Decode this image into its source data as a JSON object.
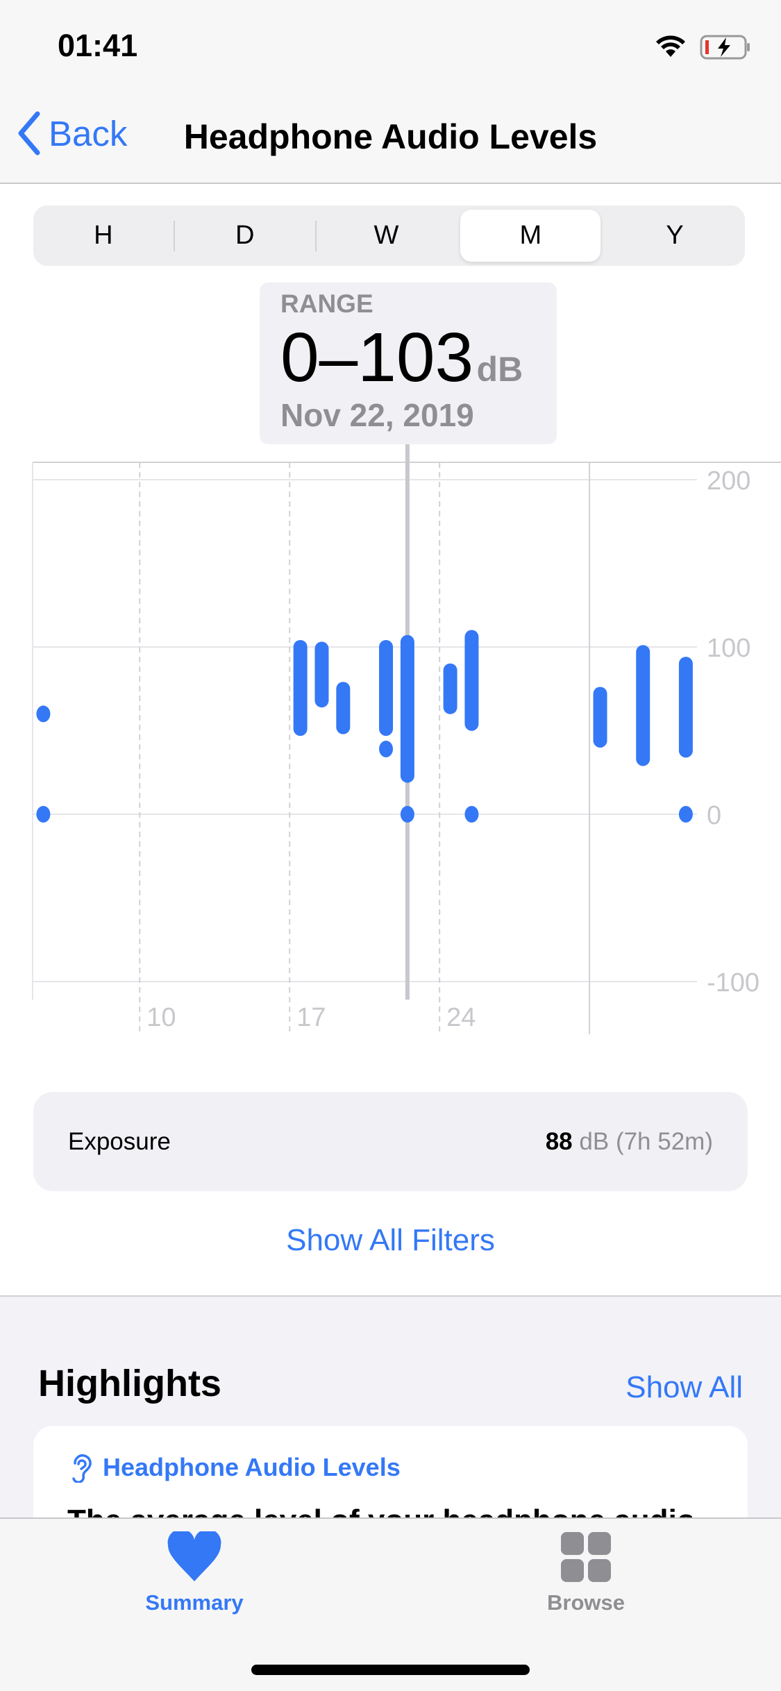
{
  "status_bar": {
    "time": "01:41",
    "wifi_icon": "wifi-icon",
    "battery_icon": "battery-charging-low-icon"
  },
  "nav": {
    "back_label": "Back",
    "title": "Headphone Audio Levels"
  },
  "segments": {
    "items": [
      "H",
      "D",
      "W",
      "M",
      "Y"
    ],
    "selected": "M"
  },
  "tooltip": {
    "label": "RANGE",
    "value": "0–103",
    "unit": "dB",
    "date": "Nov 22, 2019"
  },
  "chart_data": {
    "type": "range",
    "ylim": [
      -100,
      200
    ],
    "y_ticks": [
      "200",
      "100",
      "0",
      "-100"
    ],
    "x_range": [
      "Nov 5",
      "Dec 5"
    ],
    "x_tick_labels": [
      "10",
      "17",
      "24"
    ],
    "month_boundary": "Dec 1",
    "selected": "Nov 22",
    "grid": true,
    "color": "#3478F6",
    "points": [
      {
        "date": "Nov 5",
        "ranges": [],
        "dots": [
          60,
          0
        ]
      },
      {
        "date": "Nov 17",
        "ranges": [
          [
            51,
            100
          ]
        ],
        "dots": []
      },
      {
        "date": "Nov 18",
        "ranges": [
          [
            68,
            99
          ]
        ],
        "dots": []
      },
      {
        "date": "Nov 19",
        "ranges": [
          [
            52,
            75
          ]
        ],
        "dots": []
      },
      {
        "date": "Nov 21",
        "ranges": [
          [
            51,
            100
          ]
        ],
        "dots": [
          39
        ]
      },
      {
        "date": "Nov 22",
        "ranges": [
          [
            23,
            103
          ]
        ],
        "dots": [
          0
        ]
      },
      {
        "date": "Nov 24",
        "ranges": [
          [
            64,
            86
          ]
        ],
        "dots": []
      },
      {
        "date": "Nov 25",
        "ranges": [
          [
            54,
            106
          ]
        ],
        "dots": [
          0
        ]
      },
      {
        "date": "Dec 1",
        "ranges": [
          [
            44,
            72
          ]
        ],
        "dots": []
      },
      {
        "date": "Dec 3",
        "ranges": [
          [
            33,
            97
          ]
        ],
        "dots": []
      },
      {
        "date": "Dec 5",
        "ranges": [
          [
            38,
            90
          ]
        ],
        "dots": [
          0
        ]
      }
    ]
  },
  "exposure": {
    "label": "Exposure",
    "value": "88",
    "unit": "dB",
    "duration": "(7h 52m)"
  },
  "show_all_filters": "Show All Filters",
  "highlights": {
    "title": "Highlights",
    "show_all": "Show All",
    "card_title": "Headphone Audio Levels",
    "card_icon": "ear-icon",
    "card_text": "The average level of your headphone audio"
  },
  "tabs": [
    {
      "label": "Summary",
      "icon": "heart-icon",
      "active": true,
      "color": "#3478F6"
    },
    {
      "label": "Browse",
      "icon": "grid-icon",
      "active": false,
      "color": "#8E8E93"
    }
  ]
}
